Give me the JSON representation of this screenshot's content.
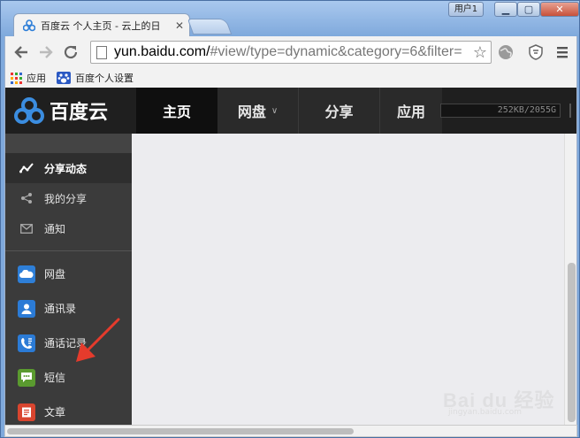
{
  "browser": {
    "tab_title": "百度云 个人主页 - 云上的日",
    "user_label": "用户1",
    "url_host": "yun.baidu.com/",
    "url_rest": "#view/type=dynamic&category=6&filter=",
    "bookmarks": [
      {
        "label": "应用"
      },
      {
        "label": "百度个人设置"
      }
    ]
  },
  "header": {
    "logo_text": "百度云",
    "nav": [
      {
        "label": "主页"
      },
      {
        "label": "网盘"
      },
      {
        "label": "分享"
      },
      {
        "label": "应用"
      }
    ],
    "quota": "252KB/2055G"
  },
  "sidebar": {
    "items": [
      {
        "label": "分享动态",
        "icon": "activity-icon"
      },
      {
        "label": "我的分享",
        "icon": "share-icon"
      },
      {
        "label": "通知",
        "icon": "mail-icon"
      }
    ],
    "apps": [
      {
        "label": "网盘",
        "icon": "cloud-icon",
        "color": "#2e7fd8"
      },
      {
        "label": "通讯录",
        "icon": "contacts-icon",
        "color": "#2b7bd6"
      },
      {
        "label": "通话记录",
        "icon": "call-log-icon",
        "color": "#2b7bd6"
      },
      {
        "label": "短信",
        "icon": "sms-icon",
        "color": "#5a9a2f"
      },
      {
        "label": "文章",
        "icon": "article-icon",
        "color": "#d9452f"
      }
    ]
  },
  "watermark": {
    "main": "Bai du 经验",
    "sub": "jingyan.baidu.com"
  }
}
